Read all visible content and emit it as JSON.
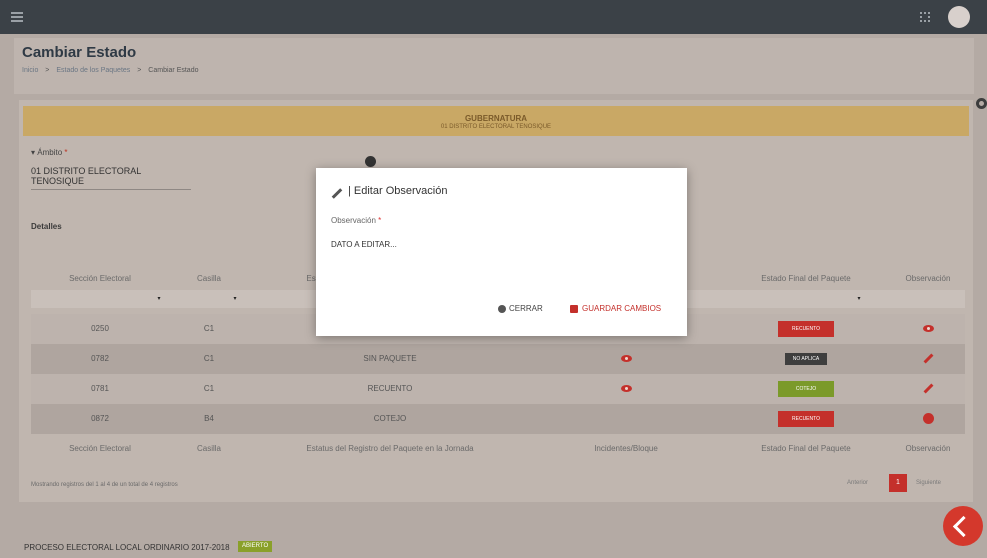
{
  "header": {
    "title": "Cambiar Estado",
    "breadcrumb": [
      "Inicio",
      "Estado de los Paquetes",
      "Cambiar Estado"
    ],
    "breadcrumb_sep": ">"
  },
  "banner": {
    "title": "GUBERNATURA",
    "subtitle": "01 DISTRITO ELECTORAL TENOSIQUE"
  },
  "ambito": {
    "label": "Ámbito",
    "required_mark": "*",
    "value": "01 DISTRITO ELECTORAL TENOSIQUE"
  },
  "section_label": "Detalles",
  "table": {
    "columns": [
      "Sección Electoral",
      "Casilla",
      "Estatus del Registro del Paquete en la Jornada",
      "Incidentes/Bloque",
      "Estado Final del Paquete",
      "Observación"
    ],
    "filter_arrow": "▾",
    "rows": [
      {
        "seccion": "0250",
        "casilla": "C1",
        "estatus": "",
        "incidente_icon": "",
        "estado_final": "RECUENTO",
        "estado_color": "#c4302b",
        "accion_icon": "eye-icon"
      },
      {
        "seccion": "0782",
        "casilla": "C1",
        "estatus": "SIN PAQUETE",
        "incidente_icon": "eye-icon",
        "estado_final": "NO APLICA",
        "estado_color": "#3e3e3e",
        "accion_icon": "pencil-icon"
      },
      {
        "seccion": "0781",
        "casilla": "C1",
        "estatus": "RECUENTO",
        "incidente_icon": "eye-icon",
        "estado_final": "COTEJO",
        "estado_color": "#7b9a2a",
        "accion_icon": "pencil-icon"
      },
      {
        "seccion": "0872",
        "casilla": "B4",
        "estatus": "COTEJO",
        "incidente_icon": "",
        "estado_final": "RECUENTO",
        "estado_color": "#c4302b",
        "accion_icon": "plus-icon"
      }
    ]
  },
  "pagination": {
    "info": "Mostrando registros del 1 al 4 de un total de 4 registros",
    "prev": "Anterior",
    "page": "1",
    "next": "Siguiente"
  },
  "footer": {
    "process": "PROCESO ELECTORAL LOCAL ORDINARIO 2017-2018",
    "badge": "ABIERTO"
  },
  "modal": {
    "title": "| Editar Observación",
    "field_label": "Observación",
    "required_mark": "*",
    "placeholder": "DATO A EDITAR...",
    "close_label": "CERRAR",
    "save_label": "GUARDAR CAMBIOS"
  }
}
